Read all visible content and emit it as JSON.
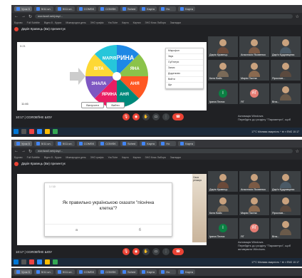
{
  "browser": {
    "tabs": [
      "Урок 5",
      "5/11 кл.",
      "5/11 кл.",
      "COMSK",
      "COMSK",
      "Sched",
      "Карта",
      "Но",
      "Карта"
    ],
    "url": "wordwall.net/play/...",
    "bookmarks": [
      "Бурово",
      "Full Subtitle",
      "Відео 8 - Курси",
      "Міжнародна день",
      "ЗНО графік",
      "YouTube",
      "Карта",
      "Картки",
      "ЗНО Клас Лабора",
      "Закладки"
    ]
  },
  "meet": {
    "presenter_label": "Дарія Кравець (Ви) презентує",
    "time_1": "10:17",
    "title": "СОЛОВ'ЇНЕ ШОУ",
    "time_2": "10:17",
    "windows_activation": [
      "Активація Windows",
      "Перейдіть до розділу \"Параметри\", щоб",
      "активувати Windows."
    ],
    "taskbar_tray": "17°C Мінлива хмарність  ^  ⊕  ≡  ENG  10:17"
  },
  "screen1": {
    "counter": "0:21",
    "wheel_segments": [
      {
        "label": "ІРИНА",
        "color": "#1e88e5"
      },
      {
        "label": "ЯНА",
        "color": "#8bc34a"
      },
      {
        "label": "АНЯ",
        "color": "#ff5722"
      },
      {
        "label": "АНЯ",
        "color": "#00897b"
      },
      {
        "label": "ЯРИНА",
        "color": "#e91e63"
      },
      {
        "label": "ЗНАЛА",
        "color": "#7e57c2"
      },
      {
        "label": "ВІТА",
        "color": "#fdd835"
      },
      {
        "label": "МАРІЯ",
        "color": "#26c6da"
      }
    ],
    "menu": [
      "Мікрофон",
      "Звук",
      "Субтитри",
      "Запис",
      "Додатково",
      "Вийти",
      "Ще"
    ],
    "buttons": [
      "Вилучити",
      "Вийти"
    ],
    "count": "11:46",
    "participants": [
      {
        "name": "Дарія Кравець",
        "color": "#6b4a3a"
      },
      {
        "name": "Анастасія Яковенко",
        "color": "#7b5a45"
      },
      {
        "name": "Дар'я Кудрявцева",
        "color": "#4b5a66"
      },
      {
        "name": "Катя Вайс",
        "color": "#7a6a58"
      },
      {
        "name": "Марія Пагіна",
        "color": "#8a6a50"
      },
      {
        "name": "Ярослав...",
        "color": "#5b4a3f"
      },
      {
        "name": "Ірина Пелих",
        "avatar": "І",
        "avatar_color": "#0b8043"
      },
      {
        "name": "ЯГ",
        "avatar": "ЯГ",
        "avatar_color": "#e67c73"
      },
      {
        "name": "Віта...",
        "color": "#6a5a4a"
      }
    ]
  },
  "screen2": {
    "question": "Як правильно українською сказати \"піснічна клетка\"?",
    "side_caption": "Своя реакція",
    "participants": [
      {
        "name": "Дарія Кравець",
        "color": "#6b4a3a"
      },
      {
        "name": "Анастасія Яковенко",
        "color": "#7b5a45"
      },
      {
        "name": "Дар'я Кудрявцева",
        "color": "#4b5a66"
      },
      {
        "name": "Катя Вайс",
        "color": "#7a6a58"
      },
      {
        "name": "Марія Пагіна",
        "color": "#8a6a50"
      },
      {
        "name": "Ярослав...",
        "color": "#5b4a3f"
      },
      {
        "name": "Ірина Пелих",
        "avatar": "І",
        "avatar_color": "#0b8043"
      },
      {
        "name": "ЯГ",
        "avatar": "ЯГ",
        "avatar_color": "#e67c73"
      },
      {
        "name": "Віта...",
        "color": "#6a5a4a"
      }
    ]
  },
  "colors": {
    "end_call": "#ea4335",
    "meet_bg": "#202124"
  }
}
